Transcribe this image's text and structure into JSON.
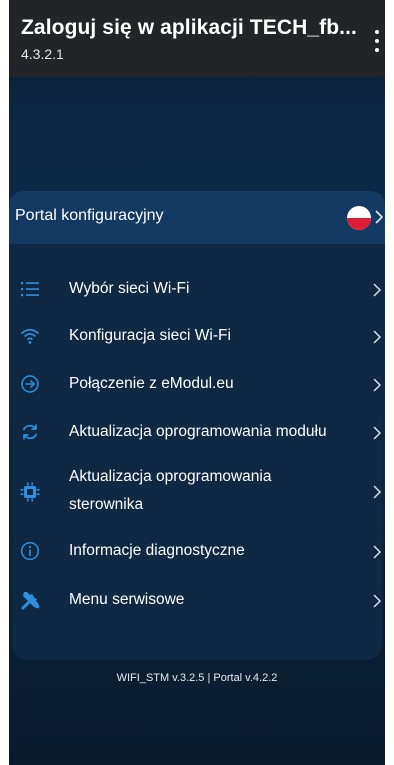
{
  "appbar": {
    "title": "Zaloguj się w aplikacji TECH_fb...",
    "subtitle": "4.3.2.1",
    "overflow_icon": "more-vert-icon"
  },
  "portal": {
    "label": "Portal konfiguracyjny",
    "language_flag": "poland-flag-icon"
  },
  "menu": {
    "items": [
      {
        "label": "Wybór sieci Wi-Fi",
        "icon": "list-icon"
      },
      {
        "label": "Konfiguracja sieci Wi-Fi",
        "icon": "wifi-icon"
      },
      {
        "label": "Połączenie z eModul.eu",
        "icon": "arrow-circle-icon"
      },
      {
        "label": "Aktualizacja oprogramowania modułu",
        "icon": "sync-icon"
      },
      {
        "label_line1": "Aktualizacja oprogramowania",
        "label_line2": "sterownika",
        "icon": "chip-icon"
      },
      {
        "label": "Informacje diagnostyczne",
        "icon": "info-icon"
      },
      {
        "label": "Menu serwisowe",
        "icon": "tools-icon"
      }
    ]
  },
  "footer": {
    "version_text": "WIFI_STM v.3.2.5 | Portal v.4.2.2"
  },
  "colors": {
    "accent": "#2f8fe0",
    "background": "#0e2a48",
    "appbar": "#232428"
  }
}
